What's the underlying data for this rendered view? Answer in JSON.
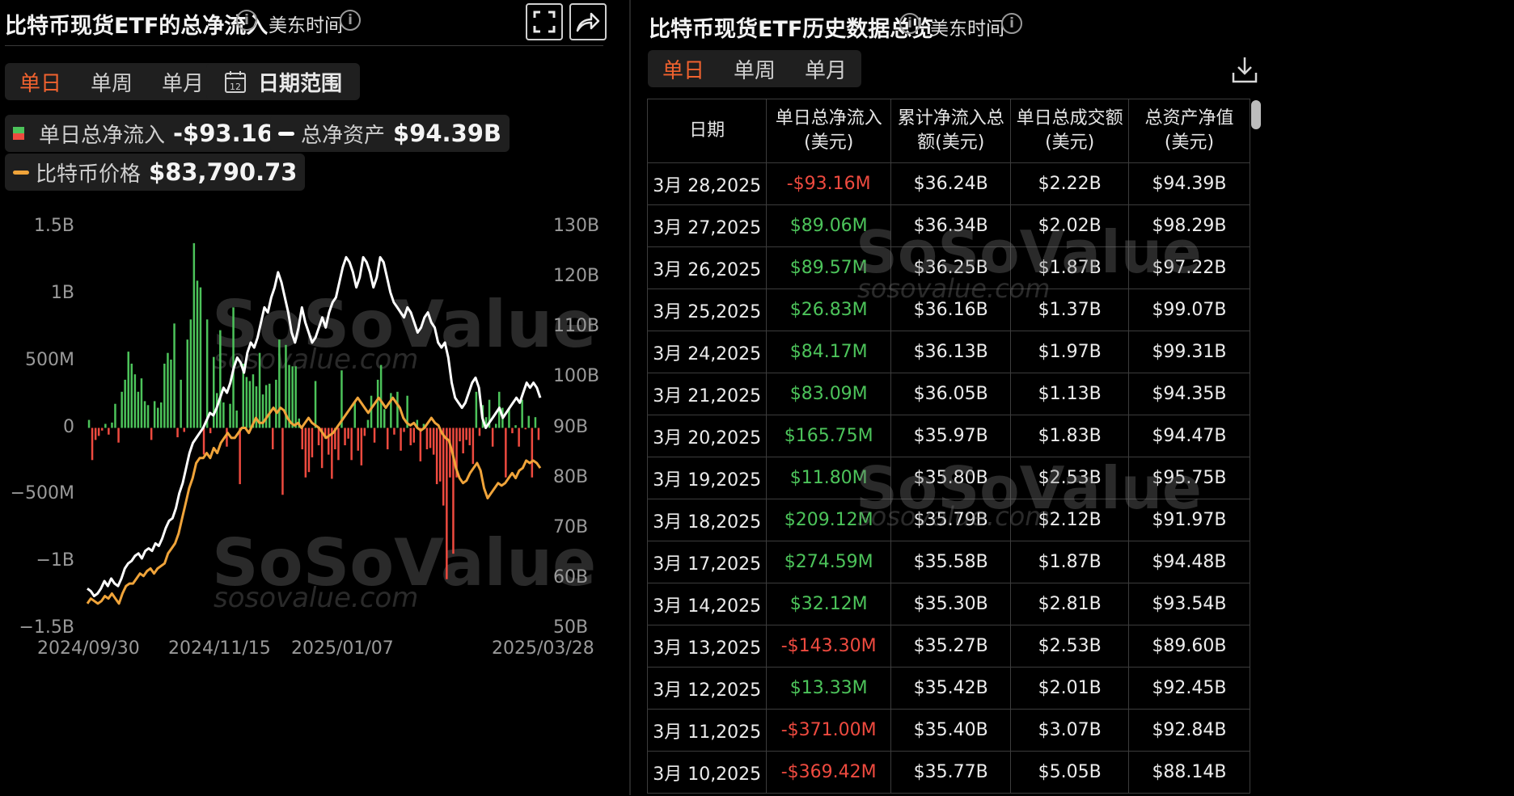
{
  "left_panel": {
    "title": "比特币现货ETF的总净流入",
    "timezone": "美东时间",
    "tabs": [
      "单日",
      "单周",
      "单月"
    ],
    "date_range_label": "日期范围",
    "calendar_day": "12",
    "legend": {
      "inflow_label": "单日总净流入",
      "inflow_value": "-$93.16M",
      "assets_label": "总净资产",
      "assets_value": "$94.39B",
      "price_label": "比特币价格",
      "price_value": "$83,790.73"
    }
  },
  "right_panel": {
    "title": "比特币现货ETF历史数据总览",
    "timezone": "美东时间",
    "tabs": [
      "单日",
      "单周",
      "单月"
    ],
    "columns": [
      "日期",
      "单日总净流入(美元)",
      "累计净流入总额(美元)",
      "单日总成交额(美元)",
      "总资产净值(美元)"
    ],
    "rows": [
      [
        "3月 28,2025",
        "-$93.16M",
        "$36.24B",
        "$2.22B",
        "$94.39B"
      ],
      [
        "3月 27,2025",
        "$89.06M",
        "$36.34B",
        "$2.02B",
        "$98.29B"
      ],
      [
        "3月 26,2025",
        "$89.57M",
        "$36.25B",
        "$1.87B",
        "$97.22B"
      ],
      [
        "3月 25,2025",
        "$26.83M",
        "$36.16B",
        "$1.37B",
        "$99.07B"
      ],
      [
        "3月 24,2025",
        "$84.17M",
        "$36.13B",
        "$1.97B",
        "$99.31B"
      ],
      [
        "3月 21,2025",
        "$83.09M",
        "$36.05B",
        "$1.13B",
        "$94.35B"
      ],
      [
        "3月 20,2025",
        "$165.75M",
        "$35.97B",
        "$1.83B",
        "$94.47B"
      ],
      [
        "3月 19,2025",
        "$11.80M",
        "$35.80B",
        "$2.53B",
        "$95.75B"
      ],
      [
        "3月 18,2025",
        "$209.12M",
        "$35.79B",
        "$2.12B",
        "$91.97B"
      ],
      [
        "3月 17,2025",
        "$274.59M",
        "$35.58B",
        "$1.87B",
        "$94.48B"
      ],
      [
        "3月 14,2025",
        "$32.12M",
        "$35.30B",
        "$2.81B",
        "$93.54B"
      ],
      [
        "3月 13,2025",
        "-$143.30M",
        "$35.27B",
        "$2.53B",
        "$89.60B"
      ],
      [
        "3月 12,2025",
        "$13.33M",
        "$35.42B",
        "$2.01B",
        "$92.45B"
      ],
      [
        "3月 11,2025",
        "-$371.00M",
        "$35.40B",
        "$3.07B",
        "$92.84B"
      ],
      [
        "3月 10,2025",
        "-$369.42M",
        "$35.77B",
        "$5.05B",
        "$88.14B"
      ]
    ]
  },
  "watermark": {
    "brand": "SoSoValue",
    "site": "sosovalue.com"
  },
  "colors": {
    "accent": "#f0622f",
    "positive": "#4cc35a",
    "negative": "#ee4a3f",
    "assets_line": "#ffffff",
    "price_line": "#f0a43a"
  },
  "chart_data": {
    "type": "bar",
    "x_ticks": [
      "2024/09/30",
      "2024/11/15",
      "2025/01/07",
      "2025/03/28"
    ],
    "y_left_ticks": [
      "1.5B",
      "1B",
      "500M",
      "0",
      "−500M",
      "−1B",
      "−1.5B"
    ],
    "y_right_ticks": [
      "130B",
      "120B",
      "110B",
      "100B",
      "90B",
      "80B",
      "70B",
      "60B",
      "50B"
    ],
    "ylim_left": [
      -1500,
      1500
    ],
    "ylim_right": [
      50,
      130
    ],
    "series": [
      {
        "name": "单日总净流入",
        "kind": "bar",
        "axis": "left",
        "unit": "M USD",
        "values": [
          60,
          -240,
          -90,
          -60,
          -20,
          30,
          -50,
          40,
          180,
          -110,
          270,
          360,
          570,
          480,
          400,
          270,
          370,
          200,
          170,
          -90,
          200,
          150,
          190,
          480,
          560,
          510,
          780,
          -70,
          360,
          -30,
          660,
          810,
          1380,
          1100,
          1050,
          -200,
          810,
          -40,
          530,
          260,
          730,
          190,
          -140,
          180,
          900,
          130,
          -420,
          480,
          380,
          350,
          400,
          310,
          560,
          250,
          320,
          330,
          -160,
          360,
          660,
          -500,
          620,
          470,
          460,
          460,
          70,
          -160,
          -370,
          -330,
          -220,
          350,
          -130,
          -300,
          -80,
          -200,
          -380,
          -160,
          -240,
          430,
          -130,
          -80,
          -240,
          200,
          -170,
          -280,
          -60,
          60,
          240,
          -110,
          360,
          470,
          140,
          -160,
          260,
          -50,
          270,
          -170,
          -30,
          240,
          -130,
          -110,
          60,
          -250,
          30,
          -160,
          -150,
          -200,
          -420,
          -400,
          -580,
          -1130,
          -370,
          -940,
          -370,
          -100,
          -190,
          -90,
          -130,
          -270,
          270,
          -60,
          170,
          80,
          210,
          -140,
          30,
          270,
          150,
          -370,
          150,
          -40,
          20,
          -140,
          210,
          -10,
          90,
          -370,
          80,
          -90
        ]
      },
      {
        "name": "总净资产",
        "kind": "line",
        "axis": "right",
        "unit": "B USD",
        "values": [
          58,
          57.5,
          56.5,
          57,
          58,
          59.5,
          58.5,
          60,
          59,
          58.5,
          60,
          62,
          63,
          63.5,
          64.5,
          65,
          64,
          65.5,
          66,
          65.5,
          67,
          66.5,
          68,
          70,
          71.5,
          72,
          74,
          77,
          79,
          82,
          85,
          87,
          88,
          89,
          90,
          91.5,
          93,
          92.5,
          94,
          96,
          98,
          97,
          99,
          102,
          104,
          103,
          101,
          105,
          107,
          106,
          108,
          111,
          114,
          113,
          116,
          118,
          121,
          119,
          116,
          113,
          109,
          107,
          110,
          114,
          111,
          109,
          107,
          108,
          110,
          112,
          110,
          113,
          115,
          116,
          119,
          122,
          124,
          123,
          121,
          118,
          120,
          124,
          123,
          121,
          118,
          120,
          124,
          123,
          120,
          117,
          115,
          114,
          113,
          112,
          114,
          113,
          111,
          109,
          110,
          112,
          113,
          111,
          110,
          107,
          106,
          107,
          104,
          99,
          96,
          95,
          94,
          95,
          97,
          99,
          100,
          98,
          92,
          90,
          91,
          92,
          93,
          94,
          92,
          93,
          94,
          95,
          96,
          95,
          97,
          99,
          98,
          99,
          98,
          96
        ]
      },
      {
        "name": "比特币价格",
        "kind": "line",
        "axis": "right",
        "unit": "B-axis scale",
        "values": [
          55,
          56,
          55.5,
          55,
          55.5,
          56.5,
          56,
          57,
          56,
          55,
          57,
          58.5,
          59,
          59,
          60,
          61,
          60.5,
          61.5,
          62,
          61,
          62,
          62.5,
          63,
          65,
          66,
          67,
          69,
          72,
          75,
          78,
          80,
          83,
          84,
          84,
          85,
          84,
          86,
          85,
          87,
          88,
          89,
          88,
          88,
          89,
          90,
          90,
          89,
          90.5,
          92,
          91,
          91,
          92,
          93,
          94,
          93,
          94,
          93.5,
          92,
          91,
          90.5,
          91,
          90,
          91,
          92,
          91,
          90.5,
          90,
          89,
          88,
          88.5,
          89,
          90,
          91,
          92,
          93,
          94,
          95,
          96,
          95,
          94,
          93,
          94,
          95,
          96,
          95,
          94,
          95,
          96,
          95,
          94,
          92,
          91,
          90.5,
          91,
          90,
          89.5,
          90,
          91,
          92,
          91,
          90.5,
          89,
          88,
          87.5,
          85,
          82,
          80,
          79,
          79.5,
          81,
          82,
          83,
          81.5,
          78,
          76,
          77,
          78,
          79,
          78.5,
          79,
          80,
          81,
          80,
          81.5,
          82,
          83.5,
          83,
          83.5,
          83,
          82
        ]
      }
    ]
  }
}
